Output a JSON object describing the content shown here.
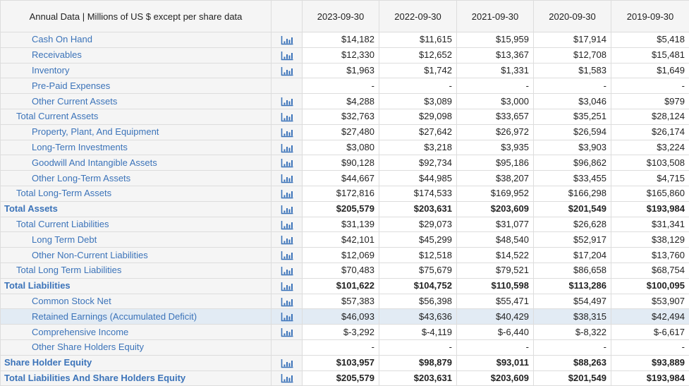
{
  "header": {
    "title": "Annual Data | Millions of US $ except per share data",
    "columns": [
      "2023-09-30",
      "2022-09-30",
      "2021-09-30",
      "2020-09-30",
      "2019-09-30"
    ]
  },
  "colors": {
    "label": "#3b73b9",
    "highlight": "#e2ebf4",
    "header_bg": "#f5f5f5"
  },
  "rows": [
    {
      "label": "Cash On Hand",
      "level": 2,
      "chart": true,
      "bold": false,
      "values": [
        "$14,182",
        "$11,615",
        "$15,959",
        "$17,914",
        "$5,418"
      ]
    },
    {
      "label": "Receivables",
      "level": 2,
      "chart": true,
      "bold": false,
      "values": [
        "$12,330",
        "$12,652",
        "$13,367",
        "$12,708",
        "$15,481"
      ]
    },
    {
      "label": "Inventory",
      "level": 2,
      "chart": true,
      "bold": false,
      "values": [
        "$1,963",
        "$1,742",
        "$1,331",
        "$1,583",
        "$1,649"
      ]
    },
    {
      "label": "Pre-Paid Expenses",
      "level": 2,
      "chart": false,
      "bold": false,
      "values": [
        "-",
        "-",
        "-",
        "-",
        "-"
      ]
    },
    {
      "label": "Other Current Assets",
      "level": 2,
      "chart": true,
      "bold": false,
      "values": [
        "$4,288",
        "$3,089",
        "$3,000",
        "$3,046",
        "$979"
      ]
    },
    {
      "label": "Total Current Assets",
      "level": 1,
      "chart": true,
      "bold": false,
      "values": [
        "$32,763",
        "$29,098",
        "$33,657",
        "$35,251",
        "$28,124"
      ]
    },
    {
      "label": "Property, Plant, And Equipment",
      "level": 2,
      "chart": true,
      "bold": false,
      "values": [
        "$27,480",
        "$27,642",
        "$26,972",
        "$26,594",
        "$26,174"
      ]
    },
    {
      "label": "Long-Term Investments",
      "level": 2,
      "chart": true,
      "bold": false,
      "values": [
        "$3,080",
        "$3,218",
        "$3,935",
        "$3,903",
        "$3,224"
      ]
    },
    {
      "label": "Goodwill And Intangible Assets",
      "level": 2,
      "chart": true,
      "bold": false,
      "values": [
        "$90,128",
        "$92,734",
        "$95,186",
        "$96,862",
        "$103,508"
      ]
    },
    {
      "label": "Other Long-Term Assets",
      "level": 2,
      "chart": true,
      "bold": false,
      "values": [
        "$44,667",
        "$44,985",
        "$38,207",
        "$33,455",
        "$4,715"
      ]
    },
    {
      "label": "Total Long-Term Assets",
      "level": 1,
      "chart": true,
      "bold": false,
      "values": [
        "$172,816",
        "$174,533",
        "$169,952",
        "$166,298",
        "$165,860"
      ]
    },
    {
      "label": "Total Assets",
      "level": 0,
      "chart": true,
      "bold": true,
      "values": [
        "$205,579",
        "$203,631",
        "$203,609",
        "$201,549",
        "$193,984"
      ]
    },
    {
      "label": "Total Current Liabilities",
      "level": 1,
      "chart": true,
      "bold": false,
      "values": [
        "$31,139",
        "$29,073",
        "$31,077",
        "$26,628",
        "$31,341"
      ]
    },
    {
      "label": "Long Term Debt",
      "level": 2,
      "chart": true,
      "bold": false,
      "values": [
        "$42,101",
        "$45,299",
        "$48,540",
        "$52,917",
        "$38,129"
      ]
    },
    {
      "label": "Other Non-Current Liabilities",
      "level": 2,
      "chart": true,
      "bold": false,
      "values": [
        "$12,069",
        "$12,518",
        "$14,522",
        "$17,204",
        "$13,760"
      ]
    },
    {
      "label": "Total Long Term Liabilities",
      "level": 1,
      "chart": true,
      "bold": false,
      "values": [
        "$70,483",
        "$75,679",
        "$79,521",
        "$86,658",
        "$68,754"
      ]
    },
    {
      "label": "Total Liabilities",
      "level": 0,
      "chart": true,
      "bold": true,
      "values": [
        "$101,622",
        "$104,752",
        "$110,598",
        "$113,286",
        "$100,095"
      ]
    },
    {
      "label": "Common Stock Net",
      "level": 2,
      "chart": true,
      "bold": false,
      "values": [
        "$57,383",
        "$56,398",
        "$55,471",
        "$54,497",
        "$53,907"
      ]
    },
    {
      "label": "Retained Earnings (Accumulated Deficit)",
      "level": 2,
      "chart": true,
      "bold": false,
      "highlight": true,
      "values": [
        "$46,093",
        "$43,636",
        "$40,429",
        "$38,315",
        "$42,494"
      ]
    },
    {
      "label": "Comprehensive Income",
      "level": 2,
      "chart": true,
      "bold": false,
      "values": [
        "$-3,292",
        "$-4,119",
        "$-6,440",
        "$-8,322",
        "$-6,617"
      ]
    },
    {
      "label": "Other Share Holders Equity",
      "level": 2,
      "chart": false,
      "bold": false,
      "values": [
        "-",
        "-",
        "-",
        "-",
        "-"
      ]
    },
    {
      "label": "Share Holder Equity",
      "level": 0,
      "chart": true,
      "bold": true,
      "values": [
        "$103,957",
        "$98,879",
        "$93,011",
        "$88,263",
        "$93,889"
      ]
    },
    {
      "label": "Total Liabilities And Share Holders Equity",
      "level": 0,
      "chart": true,
      "bold": true,
      "values": [
        "$205,579",
        "$203,631",
        "$203,609",
        "$201,549",
        "$193,984"
      ]
    }
  ]
}
